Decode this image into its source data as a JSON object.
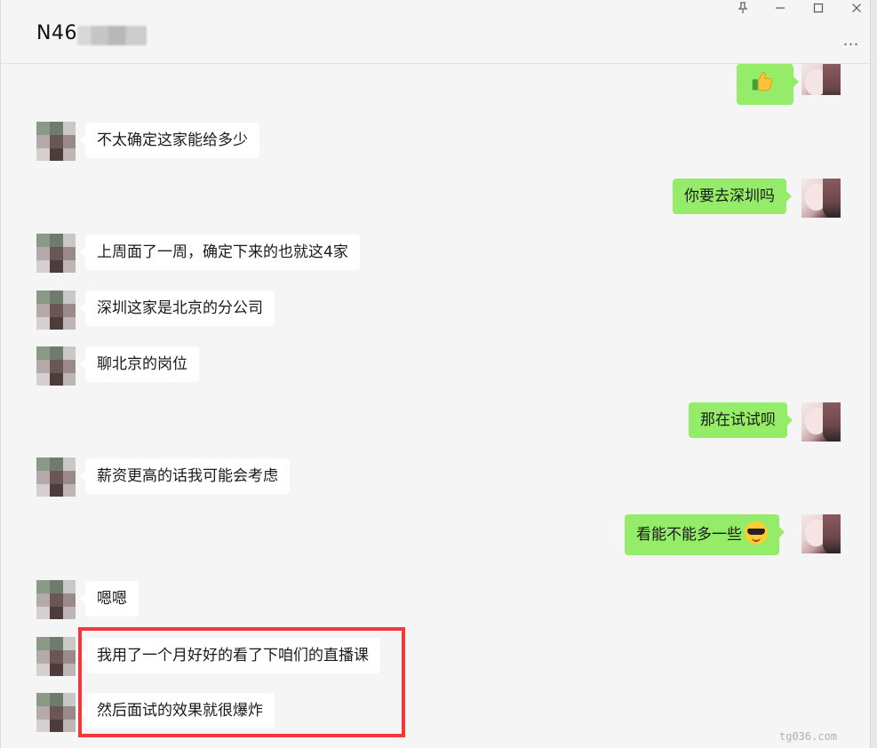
{
  "window": {
    "title": "N46",
    "controls": [
      "pin",
      "minimize",
      "maximize",
      "close"
    ],
    "more_label": "…"
  },
  "messages": [
    {
      "side": "right",
      "type": "sticker",
      "sticker": "thumbs-up-icon"
    },
    {
      "side": "left",
      "text": "不太确定这家能给多少"
    },
    {
      "side": "right",
      "text": "你要去深圳吗"
    },
    {
      "side": "left",
      "text": "上周面了一周，确定下来的也就这4家"
    },
    {
      "side": "left",
      "text": "深圳这家是北京的分公司"
    },
    {
      "side": "left",
      "text": "聊北京的岗位"
    },
    {
      "side": "right",
      "text": "那在试试呗"
    },
    {
      "side": "left",
      "text": "薪资更高的话我可能会考虑"
    },
    {
      "side": "right",
      "text": "看能不能多一些",
      "emoji": "cool-sunglasses-icon"
    },
    {
      "side": "left",
      "text": "嗯嗯"
    },
    {
      "side": "left",
      "text": "我用了一个月好好的看了下咱们的直播课"
    },
    {
      "side": "left",
      "text": "然后面试的效果就很爆炸"
    }
  ],
  "colors": {
    "sent_bubble": "#95ec69",
    "received_bubble": "#ffffff",
    "background": "#f5f5f5",
    "highlight_border": "#f0393c"
  },
  "watermark": "tg036.com"
}
